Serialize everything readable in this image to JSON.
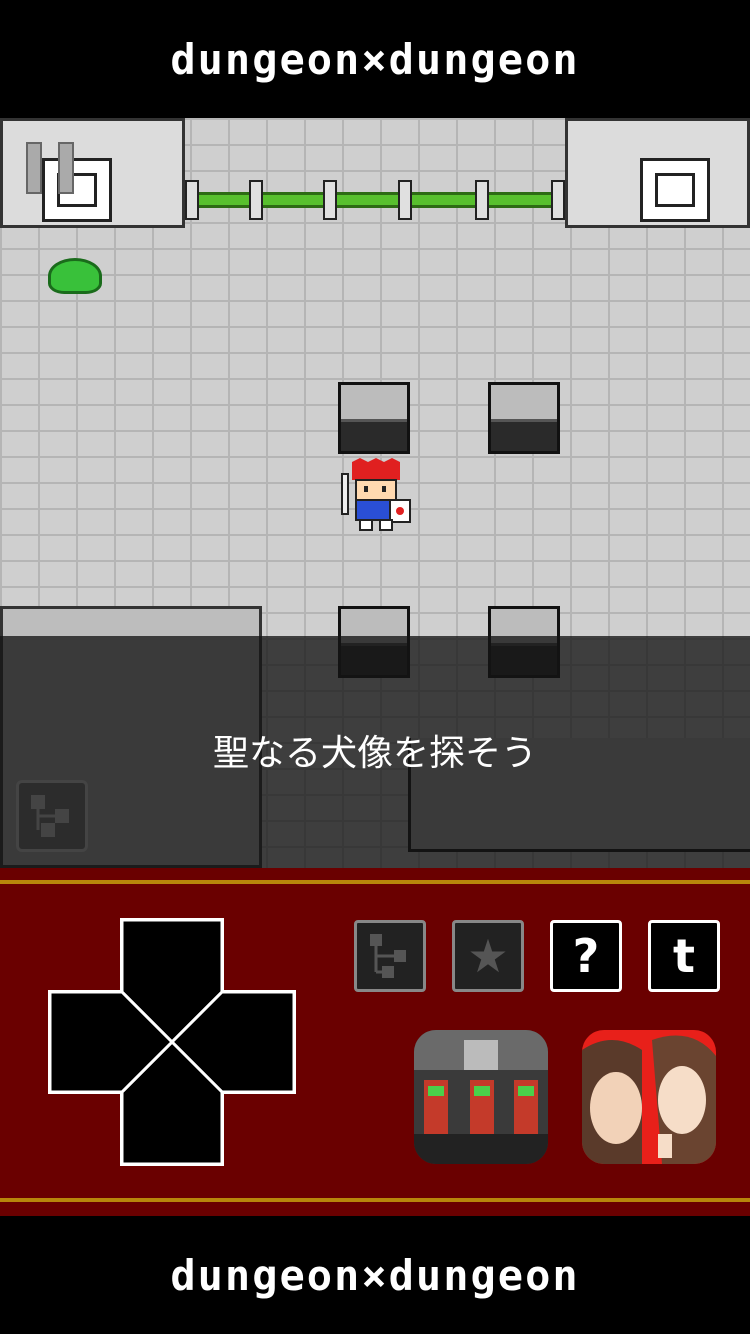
{
  "logo": {
    "text_top": "dungeon×dungeon",
    "text_bottom": "dungeon×dungeon"
  },
  "game": {
    "message": "聖なる犬像を探そう"
  },
  "controls": {
    "help_label": "?",
    "twitter_label": "t",
    "star_label": "★"
  },
  "colors": {
    "banner": "#000000",
    "floor": "#cfcfcf",
    "control_panel": "#6a0000",
    "fence_green": "#58c02e",
    "slime": "#39c13a"
  }
}
